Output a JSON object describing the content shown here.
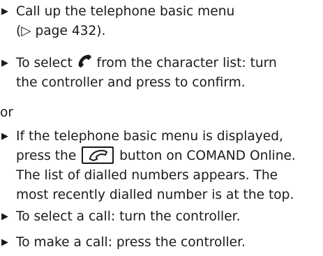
{
  "bullet_glyph": "▶",
  "steps": [
    {
      "lines": [
        "Call up the telephone basic menu",
        "(▷ page 432)."
      ]
    },
    {
      "line1_before": "To select ",
      "line1_after": " from the character list: turn",
      "line2": "the controller and press to confirm."
    },
    {
      "line1": "If the telephone basic menu is displayed,",
      "line2_before": "press the ",
      "line2_after": " button on COMAND Online.",
      "line3": "The list of dialled numbers appears. The",
      "line4": "most recently dialled number is at the top."
    },
    {
      "line1": "To select a call: turn the controller."
    },
    {
      "line1": "To make a call: press the controller."
    }
  ],
  "or_label": "or",
  "icons": {
    "character_icon": "phone-handset-icon",
    "button_icon": "phone-button-icon"
  }
}
